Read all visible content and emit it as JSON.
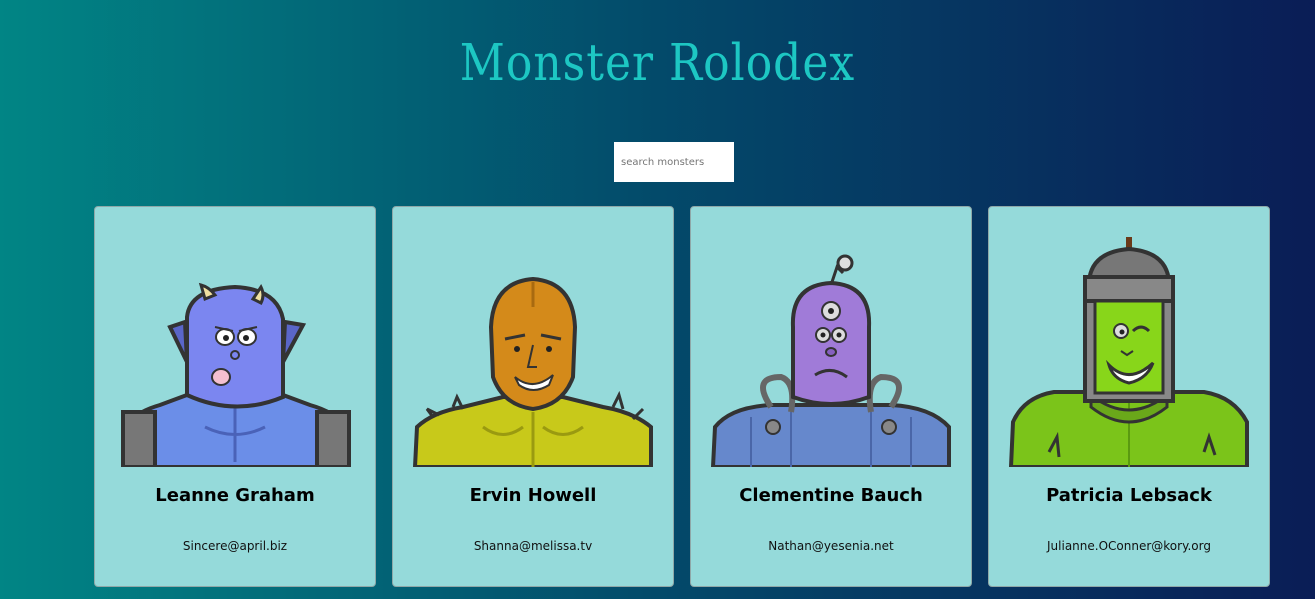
{
  "app": {
    "title": "Monster Rolodex"
  },
  "search": {
    "placeholder": "search monsters",
    "value": ""
  },
  "monsters": [
    {
      "name": "Leanne Graham",
      "email": "Sincere@april.biz",
      "avatar_icon": "blue-horned-monster-icon",
      "skin_color": "#7b86f0",
      "body_color": "#6b8ee8"
    },
    {
      "name": "Ervin Howell",
      "email": "Shanna@melissa.tv",
      "avatar_icon": "orange-spiky-monster-icon",
      "skin_color": "#d48a1a",
      "body_color": "#c8c91a"
    },
    {
      "name": "Clementine Bauch",
      "email": "Nathan@yesenia.net",
      "avatar_icon": "purple-robot-monster-icon",
      "skin_color": "#a07bd8",
      "body_color": "#6688cc"
    },
    {
      "name": "Patricia Lebsack",
      "email": "Julianne.OConner@kory.org",
      "avatar_icon": "green-helmet-monster-icon",
      "skin_color": "#88d61a",
      "body_color": "#7bc41a"
    }
  ]
}
